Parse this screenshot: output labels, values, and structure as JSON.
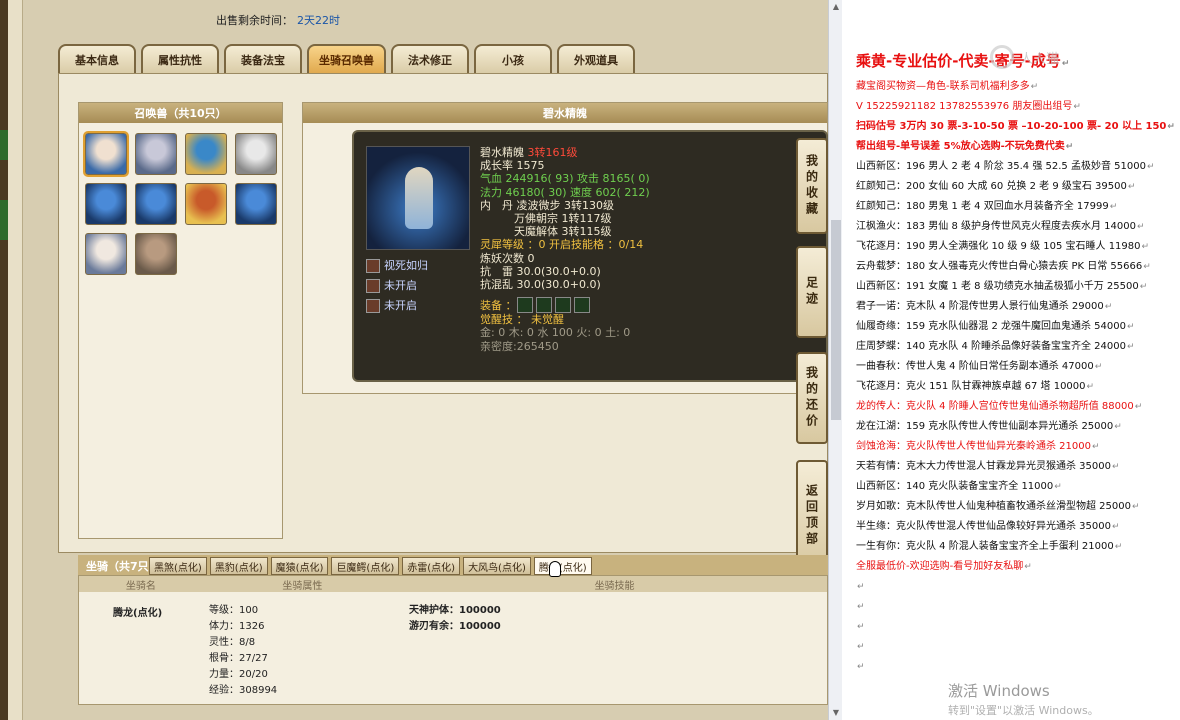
{
  "sale": {
    "label": "出售剩余时间：",
    "value": "2天22时"
  },
  "tabs": [
    "基本信息",
    "属性抗性",
    "装备法宝",
    "坐骑召唤兽",
    "法术修正",
    "小孩",
    "外观道具"
  ],
  "active_tab": "坐骑召唤兽",
  "summon_panel": {
    "title": "召唤兽（共10只）"
  },
  "detail_panel": {
    "title": "碧水精魄"
  },
  "summon": {
    "name": "碧水精魄",
    "level": "3转161级",
    "growth": "成长率 1575",
    "hp": "气血 244916( 93) 攻击 8165( 0)",
    "mp": "法力 46180( 30) 速度 602( 212)",
    "neidan_1": "内　丹 凌波微步 3转130级",
    "neidan_2": "万佛朝宗 1转117级",
    "neidan_3": "天魔解体 3转115级",
    "spirit": "灵犀等级 ：0 开启技能格 ：0/14",
    "refine": "炼妖次数 0",
    "res_1": "抗　雷 30.0(30.0+0.0)",
    "res_2": "抗混乱 30.0(30.0+0.0)",
    "equip_label": "装备 ：",
    "awaken": "觉醒技 ： 未觉醒",
    "elements": "金: 0 木: 0 水 100 火: 0 土: 0",
    "intimacy": "亲密度:265450",
    "skills": [
      "视死如归",
      "未开启",
      "未开启"
    ]
  },
  "side_buttons": [
    "我的收藏",
    "足迹",
    "我的还价",
    "返回顶部"
  ],
  "mount": {
    "title": "坐骑（共7只",
    "tabs": [
      "黑煞(点化)",
      "黑豹(点化)",
      "魔猿(点化)",
      "巨魔鳄(点化)",
      "赤雷(点化)",
      "大风鸟(点化)",
      "腾龙(点化)"
    ],
    "active_tab": "腾龙(点化)",
    "headers": [
      "坐骑名",
      "坐骑属性",
      "坐骑技能"
    ],
    "name": "腾龙(点化)",
    "attrs": [
      "等级：100",
      "体力：1326",
      "灵性：8/8",
      "根骨：27/27",
      "力量：20/20",
      "经验：308994"
    ],
    "skills": [
      "天神护体：100000",
      "游刃有余：100000"
    ]
  },
  "doc": {
    "watermark": "人人猫",
    "lines": [
      {
        "t": "乘黄-专业估价-代卖-寄号-成号",
        "s": "big"
      },
      {
        "t": "藏宝阁买物资—角色-联系司机福利多多",
        "s": "red"
      },
      {
        "t": "V 15225921182   13782553976 朋友圈出组号",
        "s": "red"
      },
      {
        "t": "扫码估号 3万内 30 票-3-10-50 票  –10-20-100 票- 20 以上 150",
        "s": "redb"
      },
      {
        "t": "帮出组号-单号误差 5%放心选购-不玩免费代卖",
        "s": "redb"
      },
      {
        "t": "山西新区：196 男人 2 老 4 阶忿 35.4 强 52.5 孟极妙音 51000",
        "s": ""
      },
      {
        "t": "红颜知己：200 女仙 60 大成 60 兑换 2 老 9 级宝石 39500",
        "s": ""
      },
      {
        "t": "红颜知己：180 男鬼 1 老 4 双回血水月装备齐全 17999",
        "s": ""
      },
      {
        "t": "江枫渔火：183 男仙 8 级护身传世风克火程度去疾水月 14000",
        "s": ""
      },
      {
        "t": "飞花逐月：190 男人全满强化 10 级 9 级 105 宝石睡人 11980",
        "s": ""
      },
      {
        "t": "云舟载梦：180 女人强毒克火传世白骨心猿去疾 PK 日常 55666",
        "s": ""
      },
      {
        "t": "山西新区：191 女魔 1 老 8 级功绩克水抽孟极狐小千万 25500",
        "s": ""
      },
      {
        "t": "君子一诺：克木队 4 阶混传世男人景行仙鬼通杀 29000",
        "s": ""
      },
      {
        "t": "仙履奇缘：159 克水队仙器混 2 龙强牛魔回血鬼通杀 54000",
        "s": ""
      },
      {
        "t": "庄周梦蝶：140 克水队 4 阶睡杀品像好装备宝宝齐全 24000",
        "s": ""
      },
      {
        "t": "一曲春秋：传世人鬼 4 阶仙日常任务副本通杀 47000",
        "s": ""
      },
      {
        "t": "飞花逐月：克火 151 队甘霖神族卓越 67 塔 10000",
        "s": ""
      },
      {
        "t": "龙的传人：克火队 4 阶睡人宫位传世鬼仙通杀物超所值 88000",
        "s": "red"
      },
      {
        "t": "龙在江湖：159 克水队传世人传世仙副本异光通杀 25000",
        "s": ""
      },
      {
        "t": "剑蚀沧海：克火队传世人传世仙异光秦岭通杀 21000",
        "s": "red"
      },
      {
        "t": "天若有情：克木大力传世混人甘霖龙异光灵猴通杀 35000",
        "s": ""
      },
      {
        "t": "山西新区：140 克火队装备宝宝齐全 11000",
        "s": ""
      },
      {
        "t": "岁月如歌：克木队传世人仙鬼种植畜牧通杀丝滑型物超 25000",
        "s": ""
      },
      {
        "t": "半生缘：克火队传世混人传世仙品像较好异光通杀 35000",
        "s": ""
      },
      {
        "t": "一生有你：克火队 4 阶混人装备宝宝齐全上手蛋利 21000",
        "s": ""
      },
      {
        "t": "全服最低价-欢迎选购-看号加好友私聊",
        "s": "red"
      }
    ],
    "activate": "激活 Windows",
    "activate_sub": "转到\"设置\"以激活 Windows。"
  }
}
